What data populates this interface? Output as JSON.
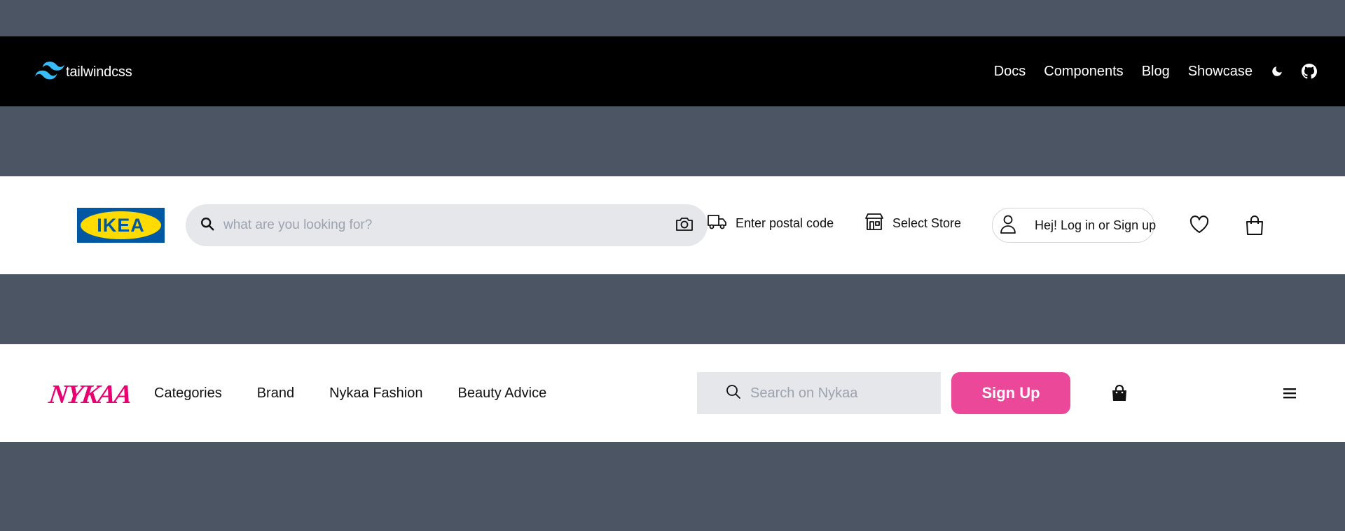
{
  "tailwind": {
    "logo_text": "tailwindcss",
    "nav": [
      "Docs",
      "Components",
      "Blog",
      "Showcase"
    ],
    "icons": [
      "moon-icon",
      "github-icon"
    ]
  },
  "ikea": {
    "logo_text": "IKEA",
    "search_placeholder": "what are you looking for?",
    "postal_label": "Enter postal code",
    "store_label": "Select Store",
    "login_label": "Hej! Log in or Sign up",
    "icons": [
      "search-icon",
      "camera-icon",
      "truck-icon",
      "store-icon",
      "user-icon",
      "heart-icon",
      "shopping-bag-icon"
    ]
  },
  "nykaa": {
    "logo_text": "NYKAA",
    "nav": [
      "Categories",
      "Brand",
      "Nykaa Fashion",
      "Beauty Advice"
    ],
    "search_placeholder": "Search on Nykaa",
    "signup_label": "Sign Up",
    "icons": [
      "search-icon",
      "shopping-bag-icon",
      "hamburger-menu-icon"
    ]
  },
  "colors": {
    "background": "#4b5563",
    "tailwind_bar": "#000000",
    "tailwind_accent": "#38bdf8",
    "ikea_blue": "#0058a3",
    "ikea_yellow": "#ffdb00",
    "nykaa_pink": "#e80071",
    "signup_button": "#ec4899",
    "search_bg": "#e5e7eb"
  }
}
